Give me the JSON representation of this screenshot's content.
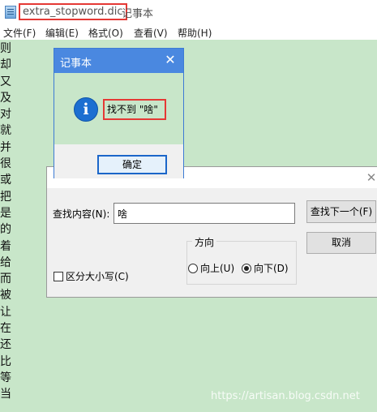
{
  "window": {
    "file_name": "extra_stopword.dic",
    "app_title": "记事本"
  },
  "menu": [
    {
      "label": "文件(F)"
    },
    {
      "label": "编辑(E)"
    },
    {
      "label": "格式(O)"
    },
    {
      "label": "查看(V)"
    },
    {
      "label": "帮助(H)"
    }
  ],
  "editor": {
    "lines": [
      "则",
      "却",
      "又",
      "及",
      "对",
      "就",
      "并",
      "很",
      "或",
      "把",
      "是",
      "的",
      "着",
      "给",
      "而",
      "被",
      "让",
      "在",
      "还",
      "比",
      "等",
      "当"
    ]
  },
  "watermark": "https://artisan.blog.csdn.net",
  "find_dialog": {
    "close_glyph": "✕",
    "find_label": "查找内容(N):",
    "find_value": "啥",
    "direction_label": "方向",
    "up_label": "向上(U)",
    "down_label": "向下(D)",
    "selected_direction": "down",
    "match_case_label": "区分大小写(C)",
    "match_case_checked": false,
    "find_next_label": "查找下一个(F)",
    "cancel_label": "取消"
  },
  "message_box": {
    "title": "记事本",
    "close_glyph": "✕",
    "icon": "info-icon",
    "icon_glyph": "i",
    "message": "找不到 \"啥\"",
    "ok_label": "确定"
  },
  "colors": {
    "editor_background": "#c8e6c9",
    "message_title_bar": "#4a88e0",
    "highlight_border": "#e53935"
  }
}
